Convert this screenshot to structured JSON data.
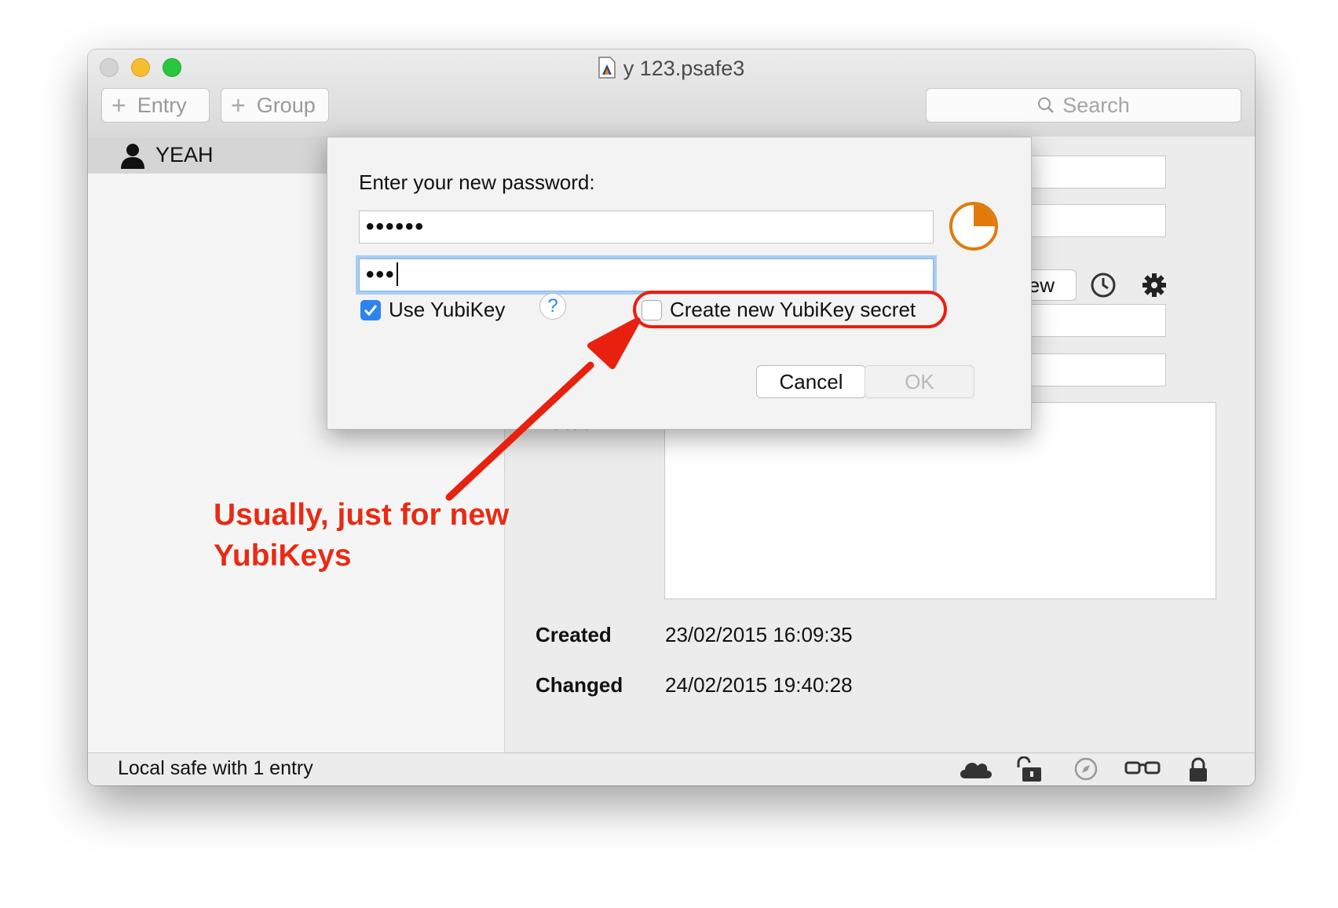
{
  "window": {
    "title": "y 123.psafe3"
  },
  "toolbar": {
    "entry_label": "Entry",
    "group_label": "Group",
    "search_placeholder": "Search"
  },
  "sidebar": {
    "items": [
      {
        "label": "YEAH",
        "icon": "user-icon"
      }
    ]
  },
  "detail": {
    "new_button_label": "New",
    "notes_label": "Notes",
    "notes_value": "•••••••••••••••••••••••••••••••••••••••••••",
    "created_label": "Created",
    "created_value": "23/02/2015 16:09:35",
    "changed_label": "Changed",
    "changed_value": "24/02/2015 19:40:28"
  },
  "dialog": {
    "prompt": "Enter your new password:",
    "password_value": "••••••",
    "confirm_value": "•••",
    "use_yubikey_label": "Use YubiKey",
    "use_yubikey_checked": true,
    "help_label": "?",
    "create_secret_label": "Create new YubiKey secret",
    "create_secret_checked": false,
    "cancel_label": "Cancel",
    "ok_label": "OK",
    "strength_fraction": 0.25
  },
  "annotation": {
    "line1": "Usually, just for new",
    "line2": "YubiKeys",
    "color": "#ea2a13"
  },
  "status": {
    "text": "Local safe with 1 entry",
    "icons": [
      "cloud-icon",
      "unlocked-icon",
      "compass-icon",
      "glasses-icon",
      "lock-icon"
    ]
  },
  "colors": {
    "accent": "#2d83f0",
    "strength": "#e07b0b",
    "highlight": "#e8200e"
  }
}
